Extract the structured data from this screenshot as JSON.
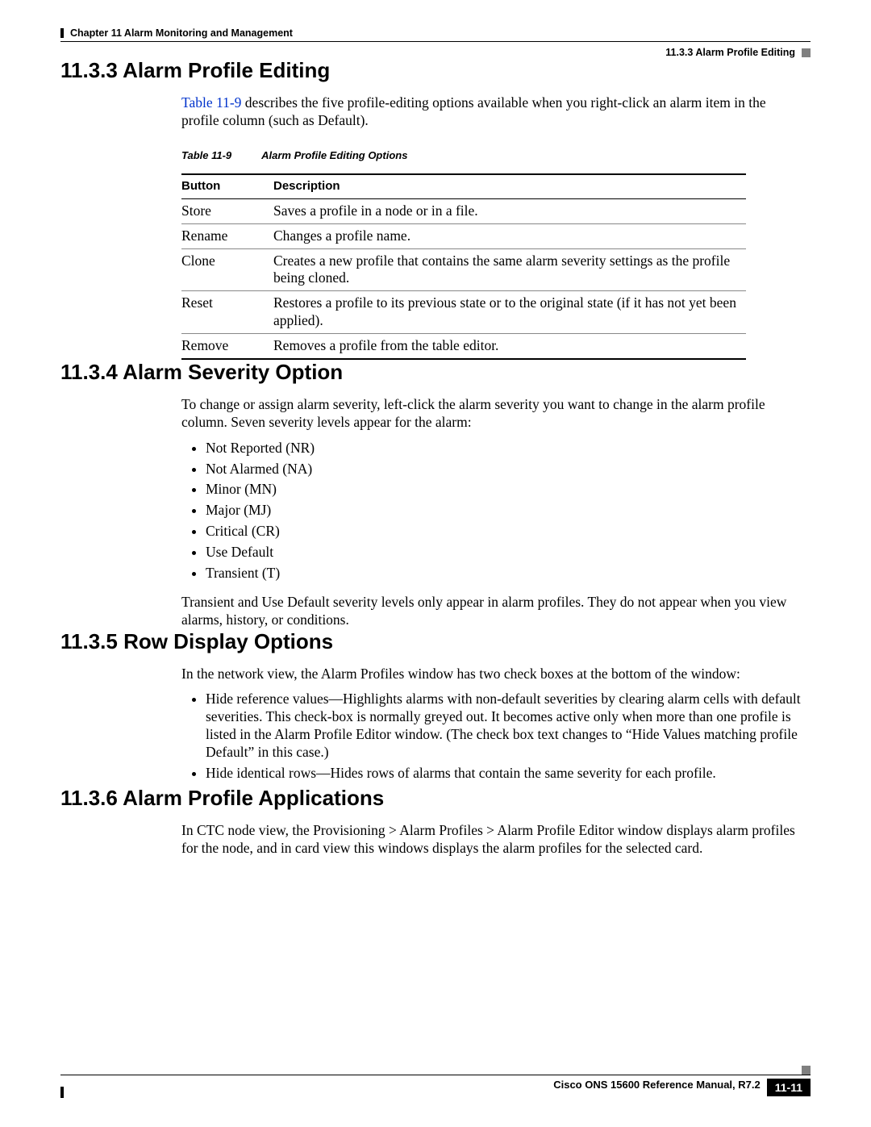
{
  "header": {
    "chapter": "Chapter 11    Alarm Monitoring and Management",
    "section_label": "11.3.3  Alarm Profile Editing"
  },
  "s1133": {
    "title": "11.3.3  Alarm Profile Editing",
    "para_pre": "",
    "xref": "Table 11-9",
    "para_post": " describes the five profile-editing options available when you right-click an alarm item in the profile column (such as Default).",
    "table_num": "Table 11-9",
    "table_title": "Alarm Profile Editing Options",
    "th1": "Button",
    "th2": "Description",
    "rows": [
      {
        "b": "Store",
        "d": "Saves a profile in a node or in a file."
      },
      {
        "b": "Rename",
        "d": "Changes a profile name."
      },
      {
        "b": "Clone",
        "d": "Creates a new profile that contains the same alarm severity settings as the profile being cloned."
      },
      {
        "b": "Reset",
        "d": "Restores a profile to its previous state or to the original state (if it has not yet been applied)."
      },
      {
        "b": "Remove",
        "d": "Removes a profile from the table editor."
      }
    ]
  },
  "s1134": {
    "title": "11.3.4  Alarm Severity Option",
    "para1": "To change or assign alarm severity, left-click the alarm severity you want to change in the alarm profile column. Seven severity levels appear for the alarm:",
    "items": [
      "Not Reported (NR)",
      "Not Alarmed (NA)",
      "Minor (MN)",
      "Major (MJ)",
      "Critical (CR)",
      "Use Default",
      "Transient (T)"
    ],
    "para2": "Transient and Use Default severity levels only appear in alarm profiles. They do not appear when you view alarms, history, or conditions."
  },
  "s1135": {
    "title": "11.3.5  Row Display Options",
    "para1": "In the network view, the Alarm Profiles window has two check boxes at the bottom of the window:",
    "items": [
      "Hide reference values—Highlights alarms with non-default severities by clearing alarm cells with default severities. This check-box is normally greyed out. It becomes active only when more than one profile is listed in the Alarm Profile Editor window. (The check box text changes to “Hide Values matching profile Default” in this case.)",
      "Hide identical rows—Hides rows of alarms that contain the same severity for each profile."
    ]
  },
  "s1136": {
    "title": "11.3.6  Alarm Profile Applications",
    "para1": "In CTC node view, the Provisioning > Alarm Profiles > Alarm Profile Editor window displays alarm profiles for the node, and in card view this windows displays the alarm profiles for the selected card."
  },
  "footer": {
    "manual": "Cisco ONS 15600 Reference Manual, R7.2",
    "page": "11-11"
  }
}
